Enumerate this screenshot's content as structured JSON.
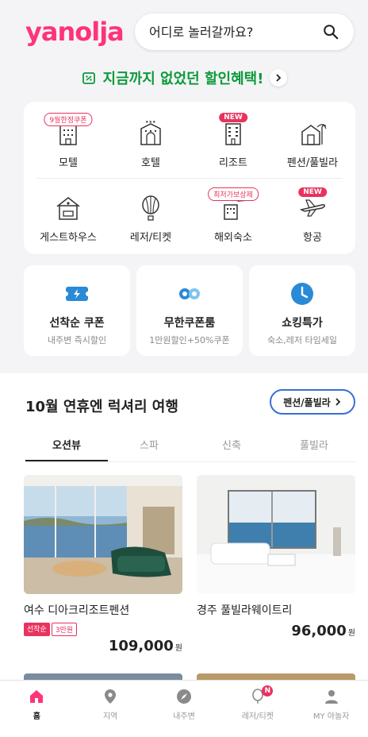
{
  "header": {
    "logo": "yanolja",
    "search_placeholder": "어디로 놀러갈까요?"
  },
  "promo": {
    "text": "지금까지 없었던 할인혜택!"
  },
  "categories": [
    {
      "label": "모텔",
      "badge": "9월한정쿠폰",
      "icon": "motel-icon"
    },
    {
      "label": "호텔",
      "badge": "",
      "icon": "hotel-icon"
    },
    {
      "label": "리조트",
      "badge": "NEW",
      "icon": "resort-icon"
    },
    {
      "label": "펜션/풀빌라",
      "badge": "",
      "icon": "pension-icon"
    },
    {
      "label": "게스트하우스",
      "badge": "",
      "icon": "guesthouse-icon"
    },
    {
      "label": "레저/티켓",
      "badge": "",
      "icon": "leisure-icon"
    },
    {
      "label": "해외숙소",
      "badge": "최저가보상제",
      "icon": "overseas-icon"
    },
    {
      "label": "항공",
      "badge": "NEW",
      "icon": "airplane-icon"
    }
  ],
  "features": [
    {
      "title": "선착순 쿠폰",
      "subtitle": "내주변 즉시할인",
      "icon": "coupon-icon"
    },
    {
      "title": "무한쿠폰룸",
      "subtitle": "1만원할인+50%쿠폰",
      "icon": "infinity-icon"
    },
    {
      "title": "쇼킹특가",
      "subtitle": "숙소,레저 타임세일",
      "icon": "clock-icon"
    }
  ],
  "section": {
    "title": "10월 연휴엔 럭셔리 여행",
    "pill": "펜션/풀빌라",
    "tabs": [
      "오션뷰",
      "스파",
      "신축",
      "풀빌라"
    ]
  },
  "listings": [
    {
      "name": "여수 디아크리조트펜션",
      "tags": [
        "선착순",
        "3만원"
      ],
      "price": "109,000",
      "unit": "원"
    },
    {
      "name": "경주 풀빌라웨이트리",
      "tags": [],
      "price": "96,000",
      "unit": "원"
    }
  ],
  "nav": [
    {
      "label": "홈",
      "icon": "home-icon"
    },
    {
      "label": "지역",
      "icon": "location-pin-icon"
    },
    {
      "label": "내주변",
      "icon": "compass-icon"
    },
    {
      "label": "레저/티켓",
      "icon": "balloon-icon",
      "badge": "N"
    },
    {
      "label": "MY 야놀자",
      "icon": "user-icon"
    }
  ],
  "colors": {
    "brand": "#ff3478",
    "promo": "#0c9a3c",
    "accent_blue": "#3a6ed8",
    "tag": "#e8335f"
  }
}
